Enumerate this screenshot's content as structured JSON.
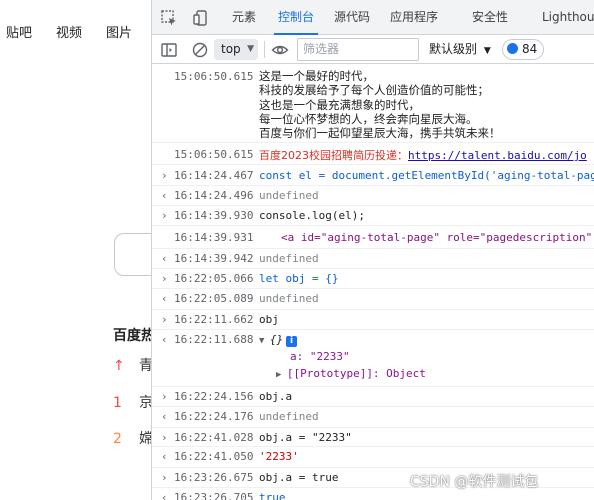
{
  "page": {
    "nav": [
      "贴吧",
      "视频",
      "图片"
    ],
    "hot_title": "百度热",
    "hot_rows": [
      {
        "rank": "↑",
        "text": "青",
        "color": "#f54545"
      },
      {
        "rank": "1",
        "text": "京",
        "color": "#f54545"
      },
      {
        "rank": "2",
        "text": "嫦",
        "color": "#ff8547"
      }
    ]
  },
  "devtools": {
    "tabs": [
      "元素",
      "控制台",
      "源代码",
      "应用程序",
      "安全性",
      "Lighthouse"
    ],
    "active_tab": "控制台",
    "toolbar": {
      "context": "top",
      "filter_placeholder": "筛选器",
      "levels": "默认级别",
      "issues_count": "84"
    },
    "console": {
      "poem_time": "15:06:50.615",
      "poem_lines": [
        "这是一个最好的时代，",
        "科技的发展给予了每个人创造价值的可能性；",
        "这也是一个最充满想象的时代，",
        "每一位心怀梦想的人，终会奔向星辰大海。",
        "百度与你们一起仰望星辰大海，携手共筑未来！"
      ],
      "recruit_time": "15:06:50.615",
      "recruit_text": "百度2023校园招聘简历投递：",
      "recruit_link": "https://talent.baidu.com/jo",
      "entries": [
        {
          "gutter": "›",
          "time": "16:14:24.467",
          "code": "const el = document.getElementById('aging-total-pag"
        },
        {
          "gutter": "‹",
          "time": "16:14:24.496",
          "code": "undefined"
        },
        {
          "gutter": "›",
          "time": "16:14:39.930",
          "code": "console.log(el);"
        },
        {
          "gutter": "",
          "time": "16:14:39.931",
          "code": "<a id=\"aging-total-page\" role=\"pagedescription\""
        },
        {
          "gutter": "‹",
          "time": "16:14:39.942",
          "code": "undefined"
        },
        {
          "gutter": "›",
          "time": "16:22:05.066",
          "code": "let obj = {}"
        },
        {
          "gutter": "‹",
          "time": "16:22:05.089",
          "code": "undefined"
        },
        {
          "gutter": "›",
          "time": "16:22:11.662",
          "code": "obj"
        },
        {
          "gutter": "‹",
          "time": "16:22:11.688",
          "code": "{}"
        },
        {
          "gutter": "›",
          "time": "16:22:24.156",
          "code": "obj.a"
        },
        {
          "gutter": "‹",
          "time": "16:22:24.176",
          "code": "undefined"
        },
        {
          "gutter": "›",
          "time": "16:22:41.028",
          "code": "obj.a = \"2233\""
        },
        {
          "gutter": "‹",
          "time": "16:22:41.050",
          "code": "'2233'"
        },
        {
          "gutter": "›",
          "time": "16:23:26.675",
          "code": "obj.a = true"
        },
        {
          "gutter": "‹",
          "time": "16:23:26.705",
          "code": "true"
        }
      ],
      "obj_expand": {
        "prop_a": "a: \"2233\"",
        "prototype": "[[Prototype]]: Object"
      }
    }
  },
  "watermark": "CSDN @软件测试包"
}
